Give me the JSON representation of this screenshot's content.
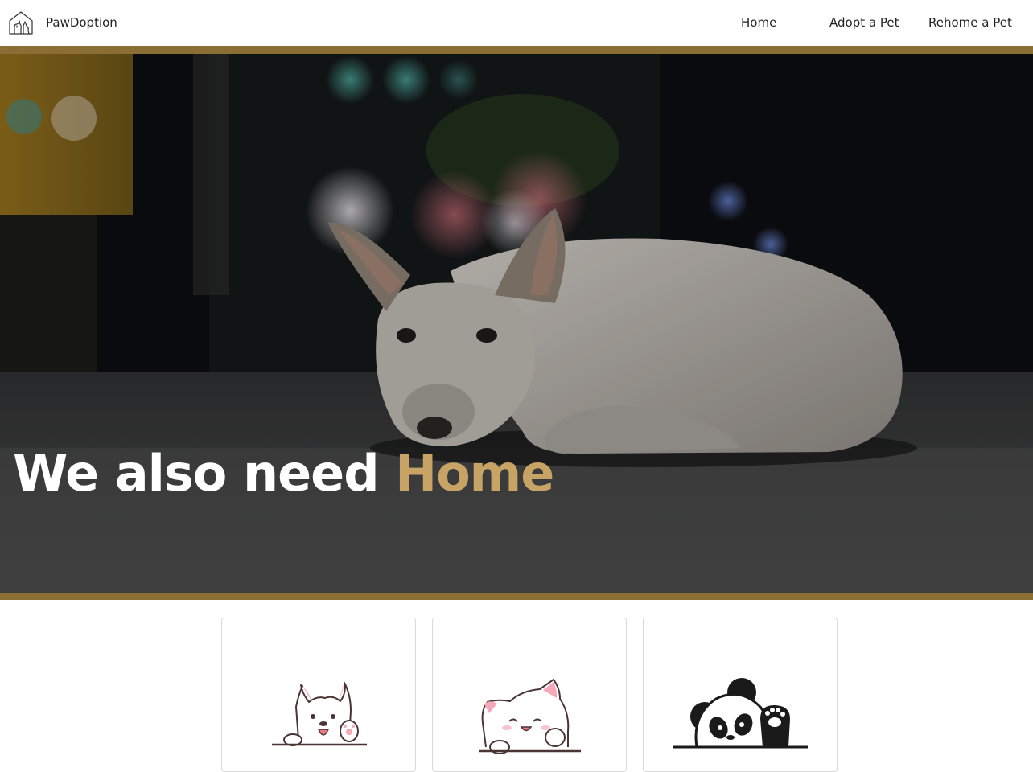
{
  "navbar": {
    "brand_name": "PawDoption",
    "logo_icon": "house-with-pets-icon",
    "links": [
      {
        "label": "Home"
      },
      {
        "label": "Adopt a Pet"
      },
      {
        "label": "Rehome a Pet"
      }
    ]
  },
  "hero": {
    "title_main": "We also need ",
    "title_accent": "Home",
    "accent_color": "#c7a466",
    "border_color": "#8b6e33",
    "image_subject": "stray-dog-lying-on-street-at-night"
  },
  "cards": [
    {
      "icon": "dog-peeking-icon"
    },
    {
      "icon": "cat-peeking-icon"
    },
    {
      "icon": "panda-waving-icon"
    }
  ]
}
